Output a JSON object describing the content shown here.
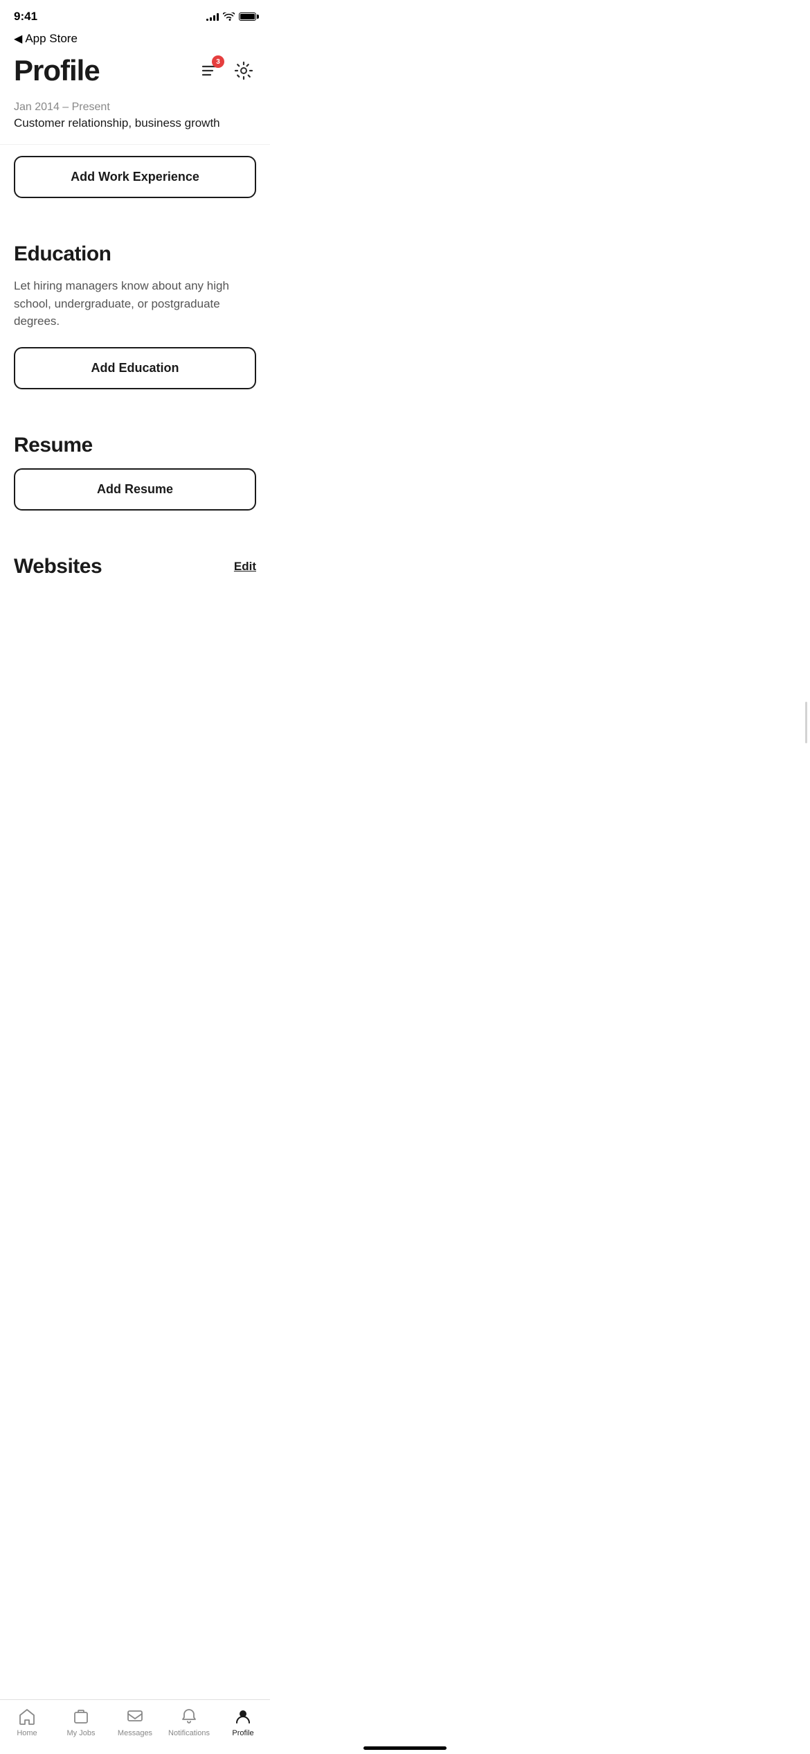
{
  "statusBar": {
    "time": "9:41",
    "backLabel": "App Store"
  },
  "header": {
    "title": "Profile",
    "notificationCount": "3",
    "notificationAriaLabel": "Notifications",
    "settingsAriaLabel": "Settings"
  },
  "scrolledContent": {
    "dateRange": "Jan 2014 – Present",
    "description": "Customer relationship, business growth"
  },
  "workExperience": {
    "addButtonLabel": "Add Work Experience"
  },
  "education": {
    "sectionTitle": "Education",
    "description": "Let hiring managers know about any high school, undergraduate, or postgraduate degrees.",
    "addButtonLabel": "Add Education"
  },
  "resume": {
    "sectionTitle": "Resume",
    "addButtonLabel": "Add Resume"
  },
  "websites": {
    "sectionTitle": "Websites",
    "editLabel": "Edit"
  },
  "tabBar": {
    "items": [
      {
        "id": "home",
        "label": "Home",
        "active": false
      },
      {
        "id": "my-jobs",
        "label": "My Jobs",
        "active": false
      },
      {
        "id": "messages",
        "label": "Messages",
        "active": false
      },
      {
        "id": "notifications",
        "label": "Notifications",
        "active": false
      },
      {
        "id": "profile",
        "label": "Profile",
        "active": true
      }
    ]
  }
}
